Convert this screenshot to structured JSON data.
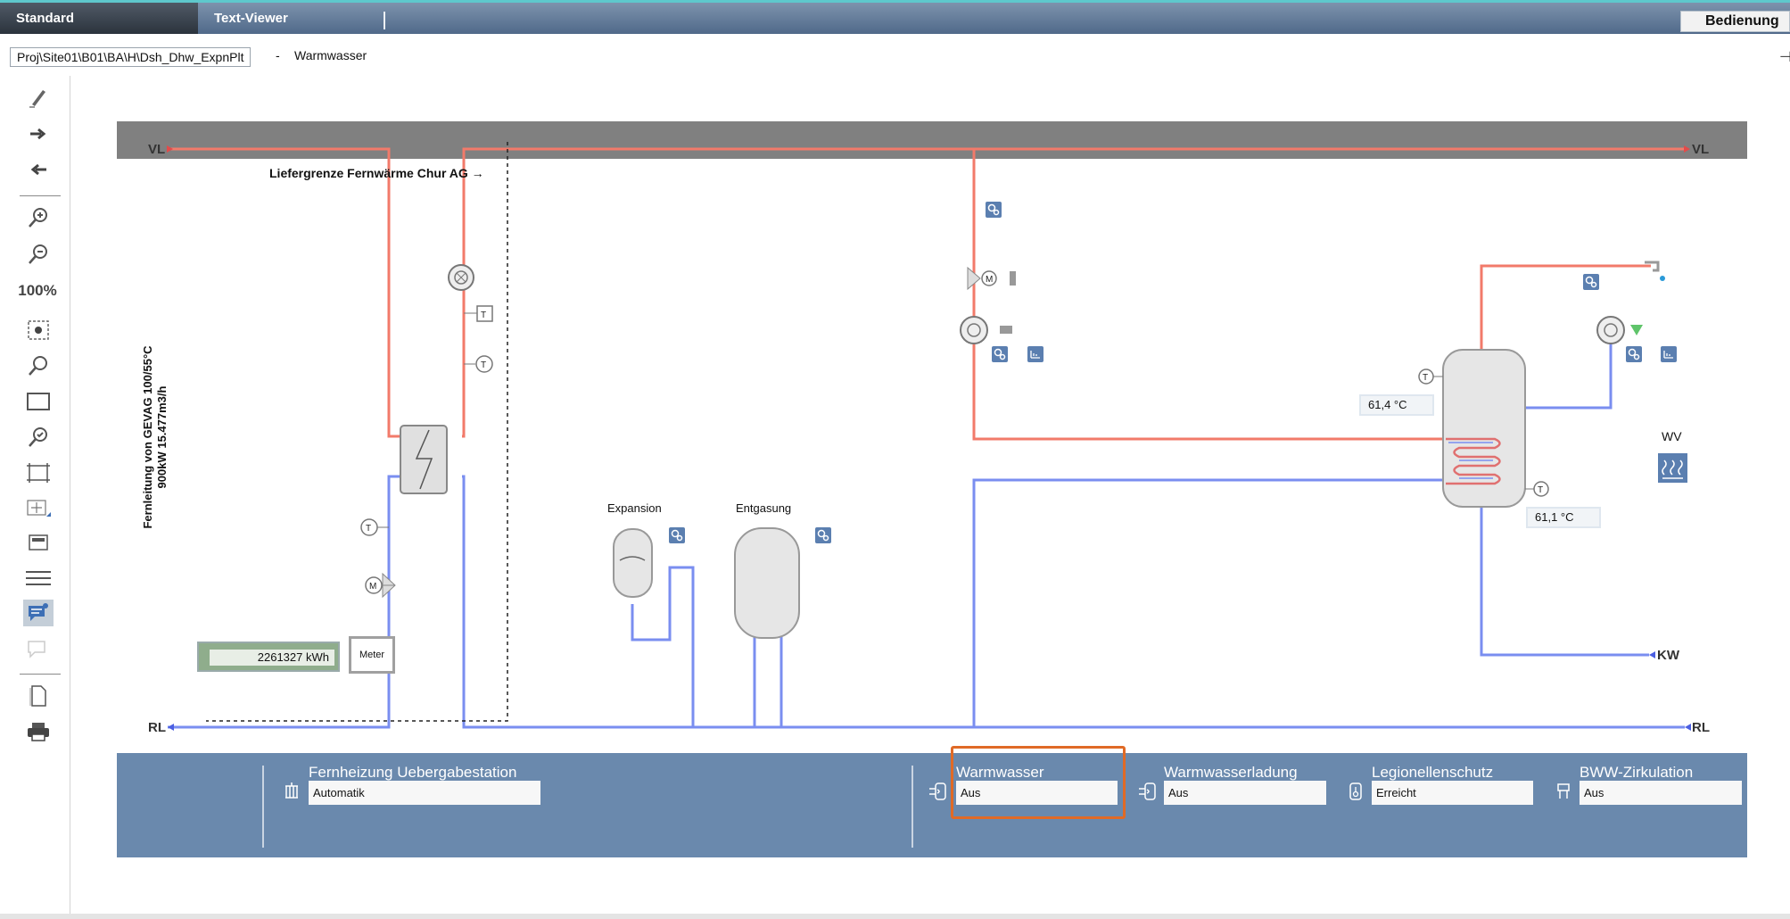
{
  "tabs": [
    {
      "label": "Standard"
    },
    {
      "label": "Text-Viewer"
    }
  ],
  "mode_label": "Bedienung",
  "path": {
    "value": "Proj\\Site01\\B01\\BA\\H\\Dsh_Dhw_ExpnPlt",
    "separator": "-",
    "title": "Warmwasser"
  },
  "toolbar": {
    "zoom": "100%",
    "icons": [
      "pencil-icon",
      "arrow-right-icon",
      "arrow-left-icon",
      "zoom-in-icon",
      "zoom-out-icon",
      "zoom-fit-icon",
      "magnifier-icon",
      "frame-icon",
      "zoom-check-icon",
      "fit-page-icon",
      "grid-icon",
      "fit-width-icon",
      "menu-icon",
      "comment-icon",
      "comment-disabled-icon",
      "page-icon",
      "print-icon"
    ]
  },
  "schematic": {
    "supply_boundary": "Liefergrenze Fernwärme Chur AG →",
    "vl_left": "VL",
    "vl_right": "VL",
    "rl_left": "RL",
    "rl_right": "RL",
    "kw": "KW",
    "wv": "WV",
    "fernleitung_line1": "Fernleitung von GEVAG 100/55°C",
    "fernleitung_line2": "900kW 15.477m3/h",
    "expansion": "Expansion",
    "entgasung": "Entgasung",
    "energy_value": "2261327 kWh",
    "meter": "Meter",
    "temp_storage_top": "61,4 °C",
    "temp_storage_bottom": "61,1 °C",
    "sensor_t": "T",
    "motor_m": "M"
  },
  "status": [
    {
      "title": "Fernheizung Uebergabestation",
      "value": "Automatik",
      "icon": "radiator-icon"
    },
    {
      "title": "Warmwasser",
      "value": "Aus",
      "icon": "water-heater-icon"
    },
    {
      "title": "Warmwasserladung",
      "value": "Aus",
      "icon": "water-heater-icon"
    },
    {
      "title": "Legionellenschutz",
      "value": "Erreicht",
      "icon": "shield-thermo-icon"
    },
    {
      "title": "BWW-Zirkulation",
      "value": "Aus",
      "icon": "circulation-icon"
    }
  ],
  "colors": {
    "supply": "#f27a6a",
    "return": "#7a8ef0",
    "panel": "#6a89ad",
    "highlight": "#e06a26",
    "header_band": "#808080"
  }
}
